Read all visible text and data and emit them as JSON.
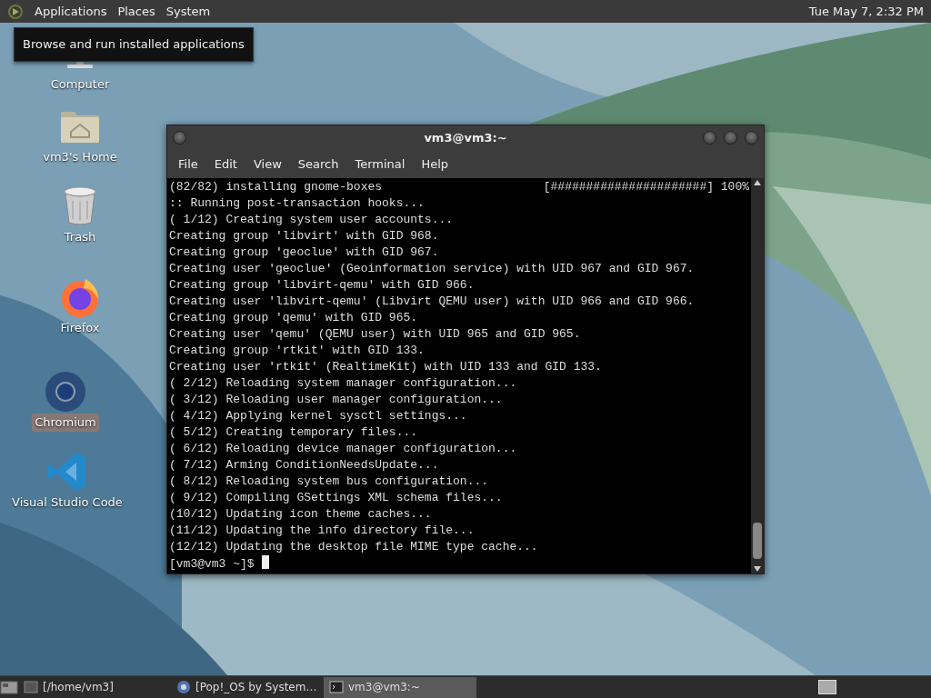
{
  "top_panel": {
    "menus": [
      "Applications",
      "Places",
      "System"
    ],
    "clock": "Tue May 7, 2:32 PM"
  },
  "tooltip": "Browse and run installed applications",
  "desktop_icons": [
    {
      "kind": "computer",
      "label": "Computer",
      "selected": false
    },
    {
      "kind": "home",
      "label": "vm3's Home",
      "selected": false
    },
    {
      "kind": "trash",
      "label": "Trash",
      "selected": false
    },
    {
      "kind": "firefox",
      "label": "Firefox",
      "selected": false
    },
    {
      "kind": "chromium",
      "label": "Chromium",
      "selected": true
    },
    {
      "kind": "vscode",
      "label": "Visual Studio Code",
      "selected": false
    }
  ],
  "terminal": {
    "title": "vm3@vm3:~",
    "menu": [
      "File",
      "Edit",
      "View",
      "Search",
      "Terminal",
      "Help"
    ],
    "lines": [
      {
        "text": "(82/82) installing gnome-boxes",
        "progress": "[######################] 100%"
      },
      {
        "text": ":: Running post-transaction hooks..."
      },
      {
        "text": "( 1/12) Creating system user accounts..."
      },
      {
        "text": "Creating group 'libvirt' with GID 968."
      },
      {
        "text": "Creating group 'geoclue' with GID 967."
      },
      {
        "text": "Creating user 'geoclue' (Geoinformation service) with UID 967 and GID 967."
      },
      {
        "text": "Creating group 'libvirt-qemu' with GID 966."
      },
      {
        "text": "Creating user 'libvirt-qemu' (Libvirt QEMU user) with UID 966 and GID 966."
      },
      {
        "text": "Creating group 'qemu' with GID 965."
      },
      {
        "text": "Creating user 'qemu' (QEMU user) with UID 965 and GID 965."
      },
      {
        "text": "Creating group 'rtkit' with GID 133."
      },
      {
        "text": "Creating user 'rtkit' (RealtimeKit) with UID 133 and GID 133."
      },
      {
        "text": "( 2/12) Reloading system manager configuration..."
      },
      {
        "text": "( 3/12) Reloading user manager configuration..."
      },
      {
        "text": "( 4/12) Applying kernel sysctl settings..."
      },
      {
        "text": "( 5/12) Creating temporary files..."
      },
      {
        "text": "( 6/12) Reloading device manager configuration..."
      },
      {
        "text": "( 7/12) Arming ConditionNeedsUpdate..."
      },
      {
        "text": "( 8/12) Reloading system bus configuration..."
      },
      {
        "text": "( 9/12) Compiling GSettings XML schema files..."
      },
      {
        "text": "(10/12) Updating icon theme caches..."
      },
      {
        "text": "(11/12) Updating the info directory file..."
      },
      {
        "text": "(12/12) Updating the desktop file MIME type cache..."
      }
    ],
    "prompt": "[vm3@vm3 ~]$"
  },
  "taskbar": {
    "items": [
      {
        "kind": "folder",
        "label": "[/home/vm3]",
        "selected": false
      },
      {
        "kind": "browser",
        "label": "[Pop!_OS by System…",
        "selected": false
      },
      {
        "kind": "terminal",
        "label": "vm3@vm3:~",
        "selected": true
      }
    ]
  }
}
